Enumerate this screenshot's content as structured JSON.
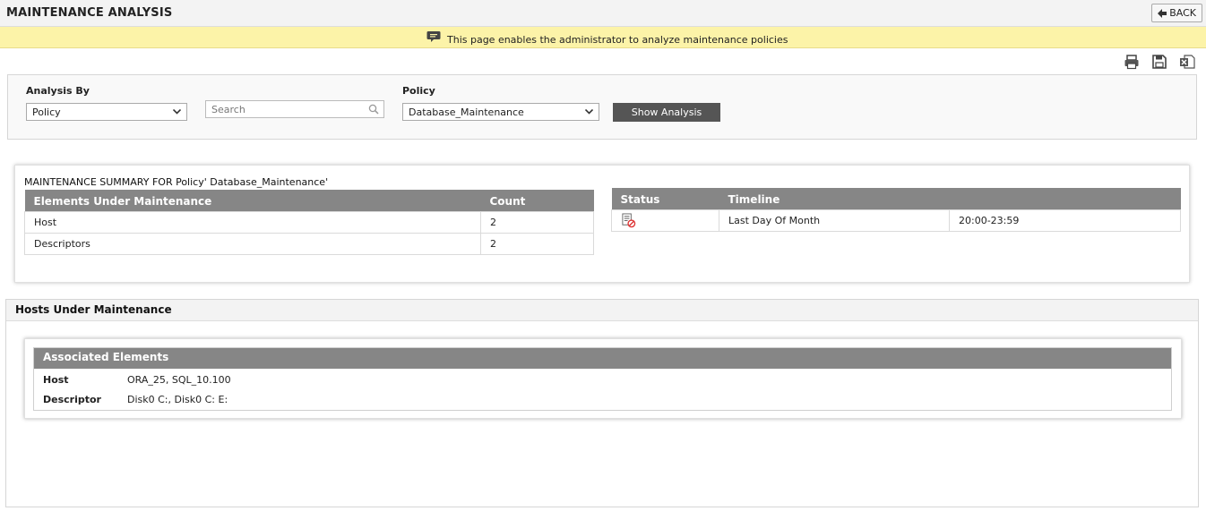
{
  "header": {
    "title": "MAINTENANCE ANALYSIS",
    "back_label": "BACK"
  },
  "info": {
    "message": "This page enables the administrator to analyze maintenance policies"
  },
  "toolbar": {
    "icons": [
      "print-icon",
      "save-icon",
      "excel-export-icon"
    ]
  },
  "filters": {
    "analysis_by_label": "Analysis By",
    "analysis_by_value": "Policy",
    "search_placeholder": "Search",
    "policy_label": "Policy",
    "policy_value": "Database_Maintenance",
    "show_button": "Show Analysis"
  },
  "summary": {
    "title": "MAINTENANCE SUMMARY FOR Policy' Database_Maintenance'",
    "elements_table": {
      "headers": [
        "Elements Under Maintenance",
        "Count"
      ],
      "rows": [
        [
          "Host",
          "2"
        ],
        [
          "Descriptors",
          "2"
        ]
      ]
    },
    "status_table": {
      "headers": [
        "Status",
        "Timeline"
      ],
      "rows": [
        {
          "status_icon": "disabled-schedule-icon",
          "timeline": "Last Day Of Month",
          "time": "20:00-23:59"
        }
      ]
    }
  },
  "hosts_section": {
    "title": "Hosts Under Maintenance",
    "associated_title": "Associated Elements",
    "rows": [
      {
        "key": "Host",
        "value": "ORA_25, SQL_10.100"
      },
      {
        "key": "Descriptor",
        "value": "Disk0 C:, Disk0 C: E:"
      }
    ]
  }
}
